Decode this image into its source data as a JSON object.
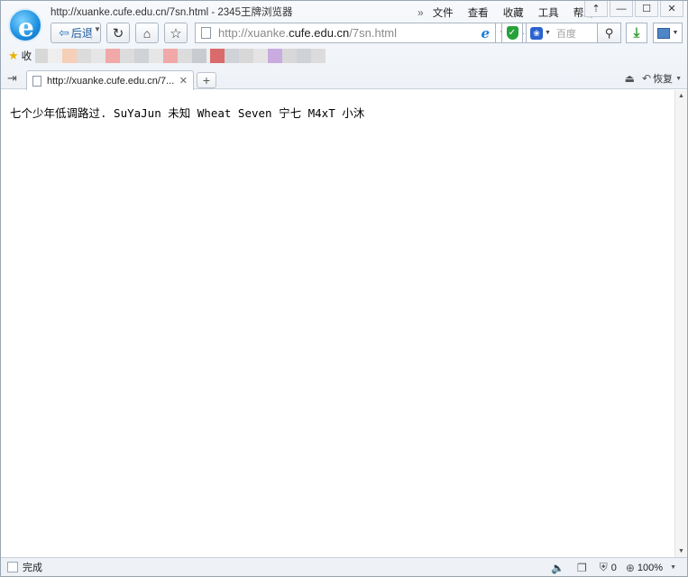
{
  "window": {
    "title": "http://xuanke.cufe.edu.cn/7sn.html - 2345王牌浏览器"
  },
  "menu": {
    "items": [
      "文件",
      "查看",
      "收藏",
      "工具",
      "帮助"
    ]
  },
  "window_controls": {
    "icons": [
      "pin-icon",
      "minimize-icon",
      "maximize-icon",
      "close-icon"
    ]
  },
  "toolbar": {
    "back_label": "后退",
    "url_prefix": "http://xuanke.",
    "url_domain": "cufe.edu.cn",
    "url_suffix": "/7sn.html",
    "search_placeholder": "百度"
  },
  "favorites": {
    "label": "收"
  },
  "tabs": [
    {
      "title": "http://xuanke.cufe.edu.cn/7..."
    }
  ],
  "tabbar": {
    "restore_label": "恢复"
  },
  "page": {
    "content": "七个少年低调路过. SuYaJun 未知 Wheat Seven 宁七 M4xT 小沐"
  },
  "statusbar": {
    "status": "完成",
    "blocked_count": "0",
    "zoom": "100%"
  },
  "colors": {
    "accent": "#1b8fe0",
    "safe_green": "#27a23a"
  }
}
